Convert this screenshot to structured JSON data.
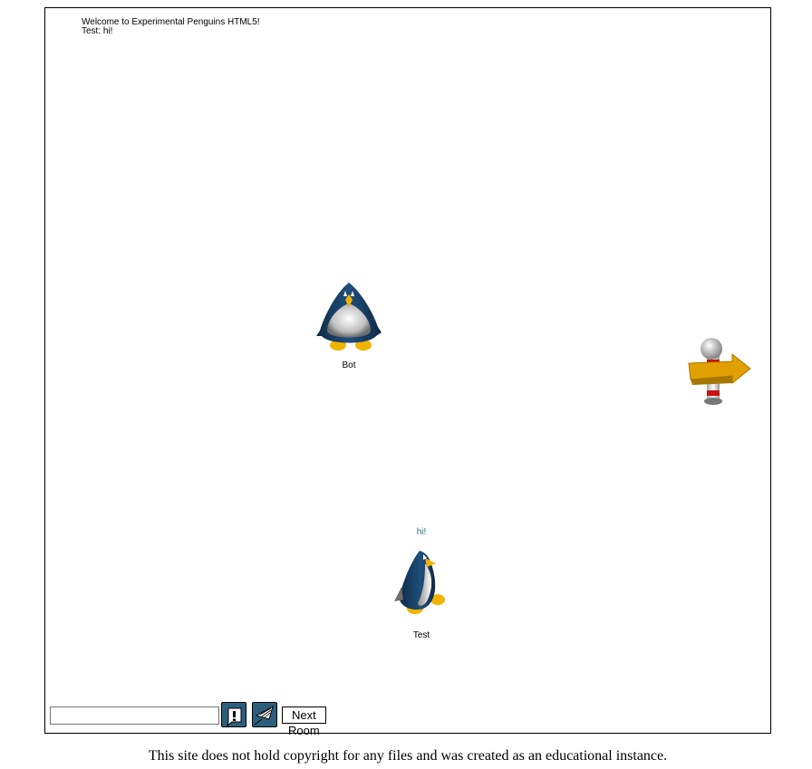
{
  "chat_log": [
    "Welcome to Experimental Penguins HTML5!",
    "Test: hi!"
  ],
  "penguins": [
    {
      "name": "Bot",
      "bubble": ""
    },
    {
      "name": "Test",
      "bubble": "hi!"
    }
  ],
  "toolbar": {
    "chat_input_value": "",
    "emote_icon": "emote-icon",
    "mail_icon": "mail-icon",
    "next_room_label": "Next Room"
  },
  "footer": "This site does not hold copyright for any files and was created as an educational instance.",
  "colors": {
    "penguin_blue": "#173f63",
    "arrow_sign": "#e0a000",
    "pole_red": "#cc1111",
    "button_blue": "#2c5f7c",
    "bubble_text": "#2a6e8a"
  }
}
